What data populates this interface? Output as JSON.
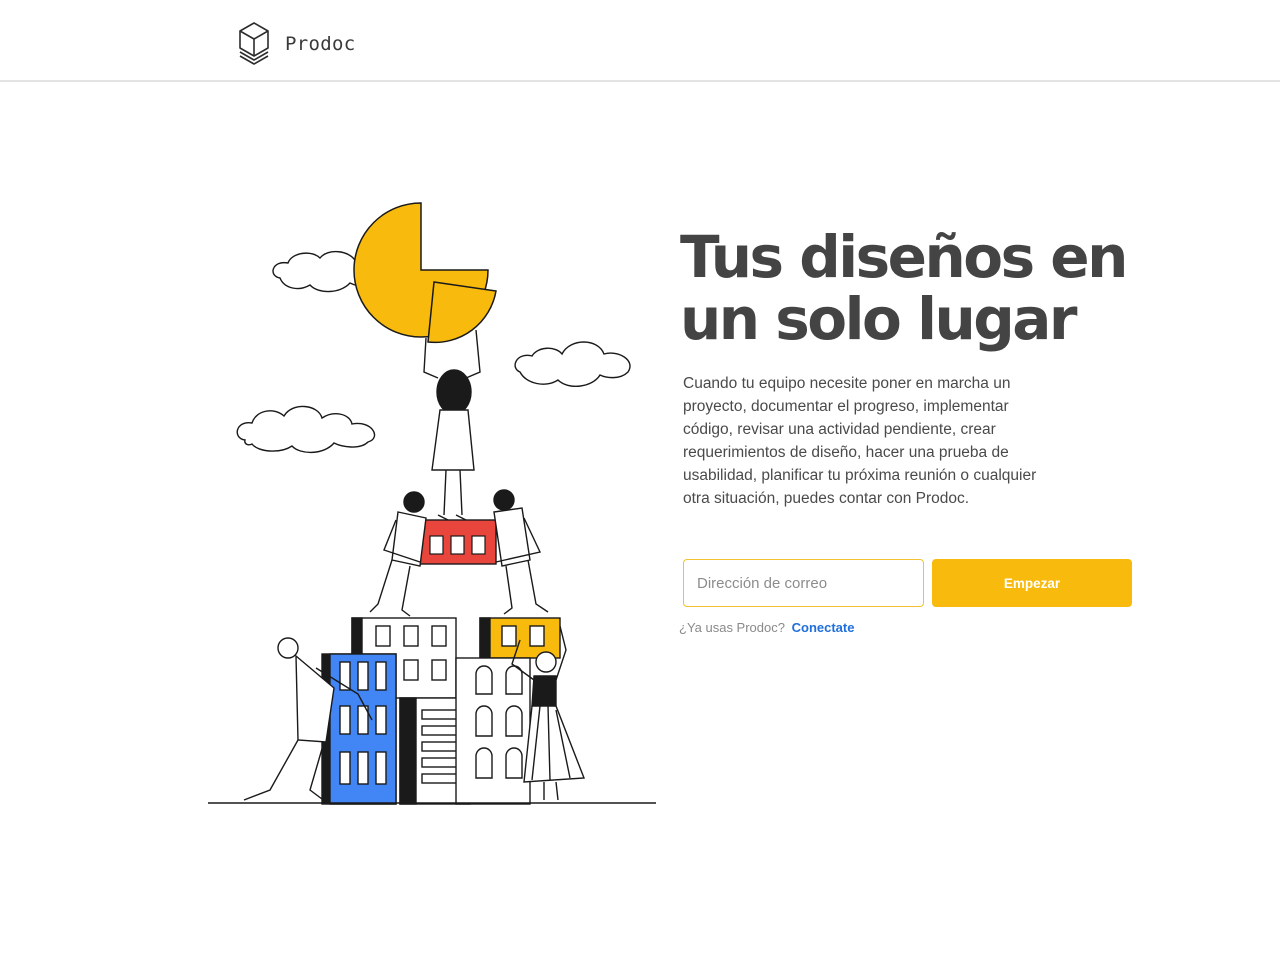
{
  "header": {
    "logo_text": "Prodoc",
    "logo_icon": "stacked-cube-icon"
  },
  "hero": {
    "title_line1": "Tus diseños en",
    "title_line2": "un solo lugar",
    "description": "Cuando tu equipo necesite poner en marcha un proyecto, documentar el progreso, implementar código, revisar una actividad pendiente, crear requerimientos de diseño, hacer una prueba de usabilidad, planificar tu próxima reunión o cualquier otra situación, puedes contar con Prodoc."
  },
  "signup": {
    "email_placeholder": "Dirección de correo",
    "email_value": "",
    "submit_label": "Empezar",
    "login_prompt": "¿Ya usas Prodoc?",
    "login_link": "Conectate"
  },
  "colors": {
    "accent": "#F8BB0D",
    "link": "#1F6FDC",
    "title": "#444444",
    "blue_building": "#4285F4",
    "red_block": "#E8453C"
  }
}
